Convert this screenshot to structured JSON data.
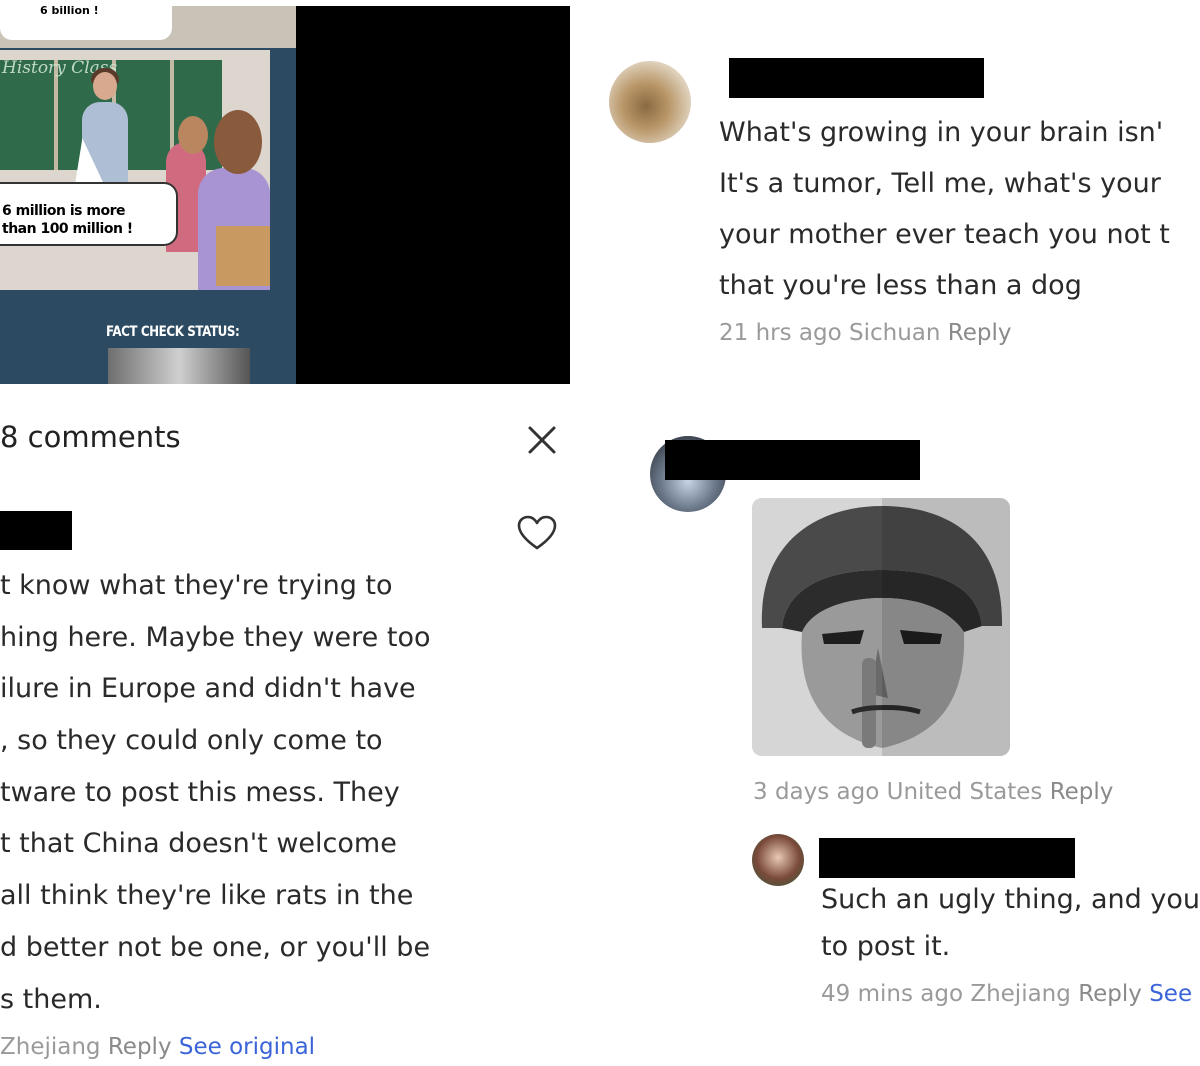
{
  "post": {
    "meme_top_text": "6 billion !",
    "board_text": "History Class",
    "speech_line1": "6 million is more",
    "speech_line2": "than 100 million !",
    "fact_check": "FACT CHECK STATUS:"
  },
  "comments_panel": {
    "count_text": "8 comments"
  },
  "left_comment": {
    "lines": [
      "t know what they're trying to",
      "hing here. Maybe they were too",
      "ilure in Europe and didn't have",
      ", so they could only come to",
      "tware to post this mess. They",
      "t that China doesn't welcome",
      "all think they're like rats in the",
      "d better not be one, or you'll be",
      "s them."
    ],
    "meta_location": "Zhejiang",
    "meta_reply": "Reply",
    "meta_see_original": "See original"
  },
  "right_comment_1": {
    "lines": [
      "What's growing in your brain isn'",
      "It's a tumor, Tell me, what's your",
      "your mother ever teach you not t",
      "that you're less than a dog"
    ],
    "meta_time": "21 hrs ago",
    "meta_location": "Sichuan",
    "meta_reply": "Reply"
  },
  "right_comment_2": {
    "meta_time": "3 days ago",
    "meta_location": "United States",
    "meta_reply": "Reply"
  },
  "right_reply": {
    "lines": [
      "Such an ugly thing, and you",
      "to post it."
    ],
    "meta_time": "49 mins ago",
    "meta_location": "Zhejiang",
    "meta_reply": "Reply",
    "meta_see_original": "See"
  },
  "icons": [
    "close-icon",
    "heart-icon"
  ],
  "colors": {
    "link": "#3b64d8",
    "meta": "#9a9a9a",
    "redaction": "#000000"
  }
}
